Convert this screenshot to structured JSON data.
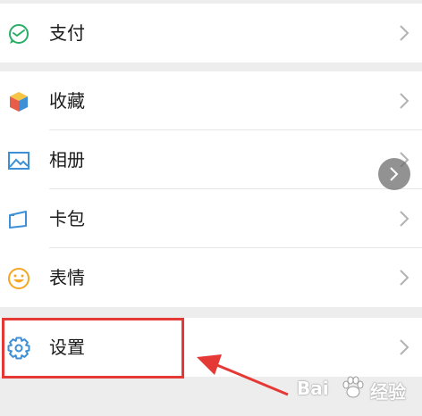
{
  "menu": {
    "group1": [
      {
        "label": "支付",
        "icon": "wallet-icon"
      }
    ],
    "group2": [
      {
        "label": "收藏",
        "icon": "cube-icon"
      },
      {
        "label": "相册",
        "icon": "image-icon"
      },
      {
        "label": "卡包",
        "icon": "card-icon"
      },
      {
        "label": "表情",
        "icon": "smiley-icon"
      }
    ],
    "group3": [
      {
        "label": "设置",
        "icon": "gear-icon"
      }
    ]
  },
  "annotation": {
    "highlight_color": "#e53935",
    "target": "设置"
  },
  "watermark": {
    "left": "Bai",
    "right": "经验",
    "logo": "paw-icon"
  },
  "colors": {
    "accent_green": "#2aae67",
    "icon_blue": "#3d8fd6",
    "smiley_orange": "#f5a623"
  }
}
